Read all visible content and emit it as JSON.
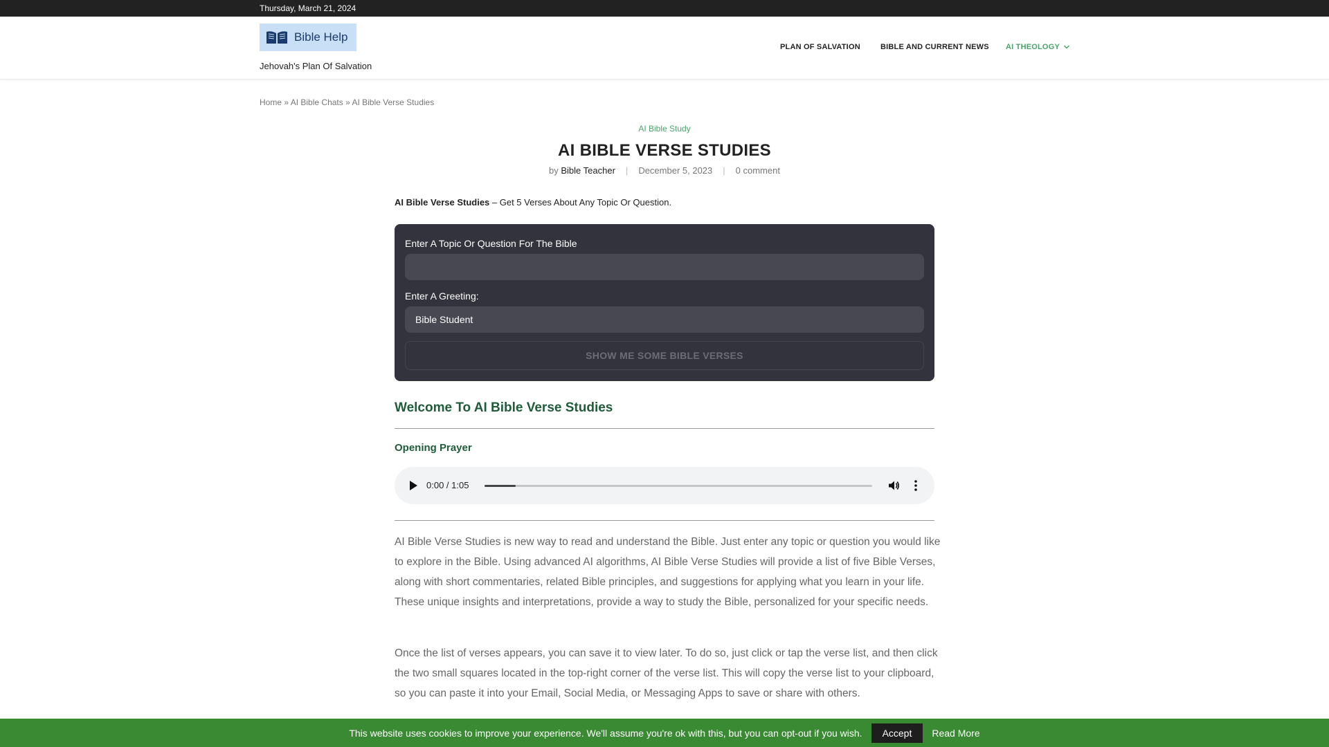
{
  "topbar": {
    "date": "Thursday, March 21, 2024"
  },
  "header": {
    "logo_text": "Bible Help",
    "tagline": "Jehovah's Plan Of Salvation",
    "nav": [
      {
        "label": "PLAN OF SALVATION"
      },
      {
        "label": "BIBLE AND CURRENT NEWS"
      },
      {
        "label": "AI THEOLOGY",
        "active": true
      }
    ],
    "accent_color": "#4aa36a"
  },
  "breadcrumb": {
    "items": [
      "Home",
      "AI Bible Chats",
      "AI Bible Verse Studies"
    ],
    "separator": "»"
  },
  "article": {
    "category": "AI Bible Study",
    "title": "AI BIBLE VERSE STUDIES",
    "by": "by",
    "author": "Bible Teacher",
    "date": "December 5, 2023",
    "comments": "0 comment",
    "intro_bold": "AI Bible Verse Studies",
    "intro_rest": " – Get 5 Verses About Any Topic Or Question."
  },
  "form": {
    "topic_label": "Enter A Topic Or Question For The Bible",
    "topic_value": "",
    "greeting_label": "Enter A Greeting:",
    "greeting_value": "Bible Student",
    "submit_label": "SHOW ME SOME BIBLE VERSES"
  },
  "content": {
    "welcome_heading": "Welcome To AI Bible Verse Studies",
    "prayer_heading": "Opening Prayer",
    "audio": {
      "time": "0:00 / 1:05",
      "progress_fraction": 0.08,
      "icons": [
        "play-icon",
        "volume-icon",
        "more-options-icon"
      ]
    },
    "paragraph_1": "AI Bible Verse Studies is new way to read and understand the Bible. Just enter any topic or question you would like to explore in the Bible. Using advanced AI algorithms, AI Bible Verse Studies will provide a list of five Bible Verses, along with short commentaries, related Bible principles, and suggestions for applying what you learn in your life. These unique insights and interpretations, provide a way to study the Bible, personalized for your specific needs.",
    "paragraph_2": "Once the list of verses appears, you can save it to view later. To do so, just click or tap the verse list, and then click the two small squares located in the top-right corner of the verse list. This will copy the verse list to your clipboard, so you can paste it into your Email, Social Media, or Messaging Apps to save or share with others."
  },
  "cookie_bar": {
    "message": "This website uses cookies to improve your experience. We'll assume you're ok with this, but you can opt-out if you wish.",
    "accept_label": "Accept",
    "read_more_label": "Read More",
    "background_color": "#3a8a33"
  }
}
